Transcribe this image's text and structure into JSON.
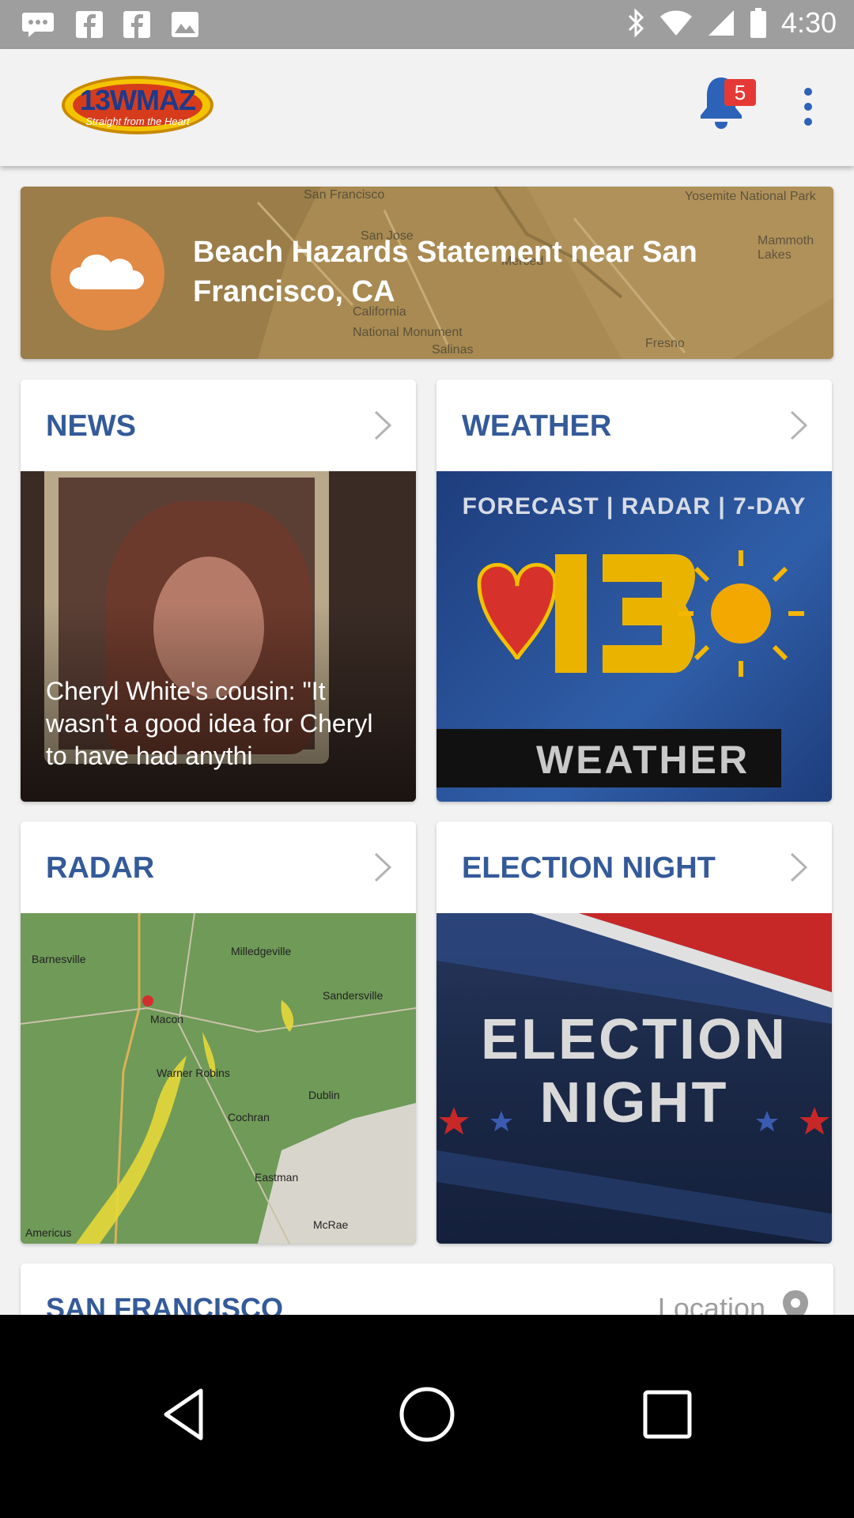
{
  "status_bar": {
    "time": "4:30",
    "left_icons": [
      "chat-icon",
      "facebook-icon",
      "facebook-icon",
      "picture-icon"
    ],
    "right_icons": [
      "bluetooth-icon",
      "wifi-icon",
      "signal-icon",
      "battery-icon"
    ]
  },
  "app_bar": {
    "logo_text": "13WMAZ",
    "logo_tagline": "Straight from the Heart",
    "notification_count": "5"
  },
  "alert": {
    "text": "Beach Hazards Statement near San Francisco, CA",
    "map_labels": [
      "San Francisco",
      "San Jose",
      "Yosemite National Park",
      "Mammoth Lakes",
      "Fresno",
      "Merced",
      "California",
      "National Monument",
      "Salinas"
    ]
  },
  "cards": [
    {
      "title": "NEWS",
      "caption": "Cheryl White's cousin: \"It wasn't a good idea for Cheryl to have had anythi"
    },
    {
      "title": "WEATHER",
      "image_top_text": "FORECAST | RADAR | 7-DAY",
      "image_bottom_text": "WEATHER"
    },
    {
      "title": "RADAR",
      "map_labels": [
        "Barnesville",
        "Milledgeville",
        "Sandersville",
        "Macon",
        "Warner Robins",
        "Dublin",
        "Cochran",
        "Eastman",
        "McRae",
        "Americus"
      ]
    },
    {
      "title": "ELECTION NIGHT",
      "image_text_line1": "ELECTION",
      "image_text_line2": "NIGHT"
    }
  ],
  "location_card": {
    "city": "SAN FRANCISCO",
    "label": "Location"
  },
  "colors": {
    "card_title": "#345a99",
    "alert_icon": "#e08a45",
    "badge": "#e53935"
  }
}
